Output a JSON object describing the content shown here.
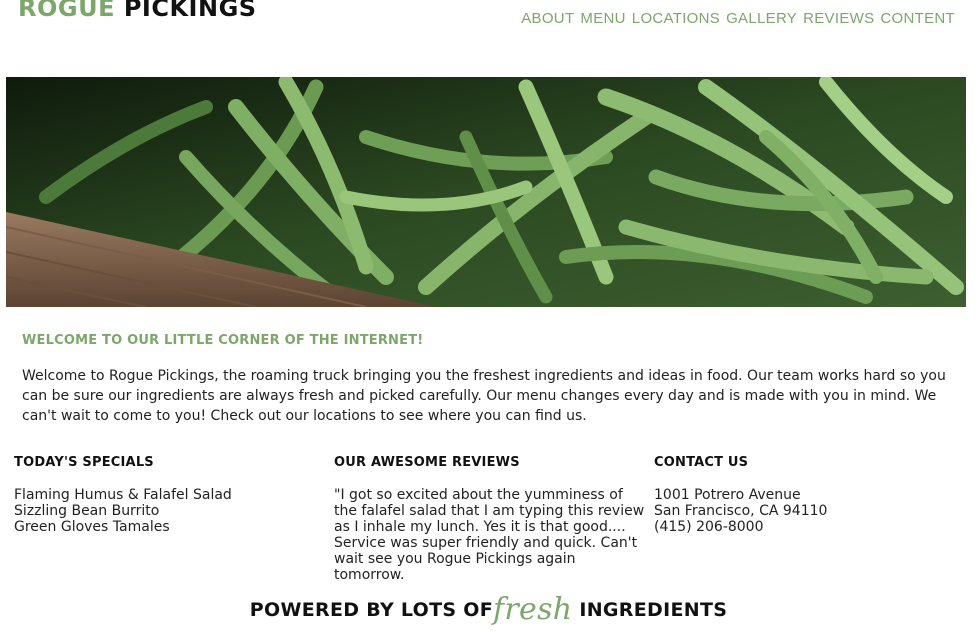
{
  "header": {
    "logo_part1": "ROGUE",
    "logo_part2": "PICKINGS",
    "nav": [
      "ABOUT",
      "MENU",
      "LOCATIONS",
      "GALLERY",
      "REVIEWS",
      "CONTENT"
    ]
  },
  "hero": {
    "image": "green-beans-photo"
  },
  "welcome": {
    "title": "WELCOME TO OUR LITTLE CORNER OF THE INTERNET!",
    "body": "Welcome to Rogue Pickings, the roaming truck bringing you the freshest ingredients and ideas in food. Our team works hard so you can be sure our ingredients are always fresh and picked carefully. Our menu changes every day and is made with you in mind. We can't wait to come to you! Check out our locations to see where you can find us."
  },
  "specials": {
    "title": "TODAY'S SPECIALS",
    "items": [
      "Flaming Humus & Falafel Salad",
      "Sizzling Bean Burrito",
      "Green Gloves Tamales"
    ]
  },
  "reviews": {
    "title": "OUR AWESOME REVIEWS",
    "text": "\"I got so excited about the yumminess of the falafel salad that I am typing this review as I inhale my lunch. Yes it is that good.... Service was super friendly and quick. Can't wait see you Rogue Pickings again tomorrow."
  },
  "contact": {
    "title": "CONTACT US",
    "lines": [
      "1001 Potrero Avenue",
      "San Francisco, CA 94110",
      "(415) 206-8000"
    ]
  },
  "footer": {
    "part1": "POWERED BY LOTS OF",
    "accent": "fresh",
    "part2": "INGREDIENTS"
  },
  "colors": {
    "accent": "#7da66b",
    "text": "#222222"
  }
}
